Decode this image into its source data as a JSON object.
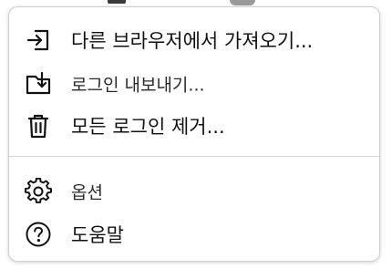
{
  "menu": {
    "items": [
      {
        "label": "다른 브라우저에서 가져오기...",
        "icon": "import-icon"
      },
      {
        "label": "로그인 내보내기...",
        "icon": "export-folder-icon"
      },
      {
        "label": "모든 로그인 제거...",
        "icon": "trash-icon"
      },
      {
        "label": "옵션",
        "icon": "gear-icon"
      },
      {
        "label": "도움말",
        "icon": "help-icon"
      }
    ]
  },
  "colors": {
    "text": "#111111",
    "border": "#cfcfcf",
    "divider": "#d6d6d6",
    "background": "#ffffff"
  }
}
